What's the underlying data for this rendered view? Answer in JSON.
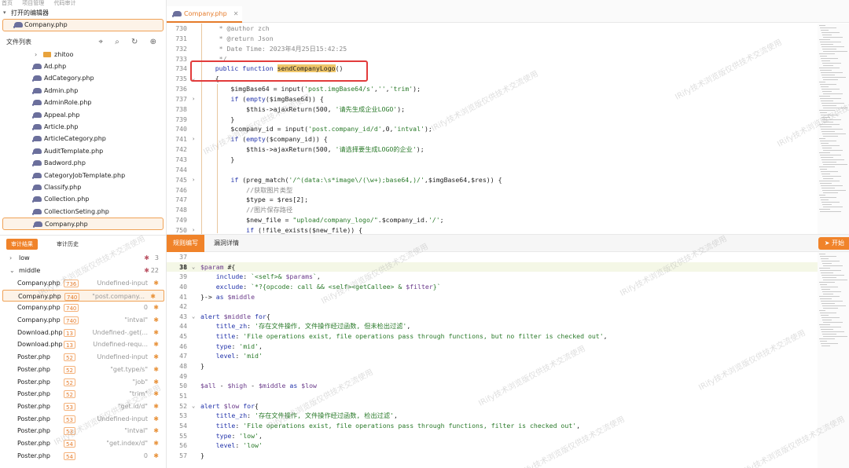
{
  "breadcrumb": [
    "首页",
    "项目管理",
    "代码审计"
  ],
  "open_editors": {
    "title": "打开的编辑器",
    "file": "Company.php"
  },
  "files": {
    "title": "文件列表",
    "folder": "zhitoo",
    "items": [
      "Ad.php",
      "AdCategory.php",
      "Admin.php",
      "AdminRole.php",
      "Appeal.php",
      "Article.php",
      "ArticleCategory.php",
      "AuditTemplate.php",
      "Badword.php",
      "CategoryJobTemplate.php",
      "Classify.php",
      "Collection.php",
      "CollectionSeting.php",
      "Company.php"
    ]
  },
  "result_tabs": {
    "active": "审计结果",
    "other": "审计历史"
  },
  "groups": {
    "low": {
      "label": "low",
      "count": "3"
    },
    "middle": {
      "label": "middle",
      "count": "22"
    }
  },
  "results": [
    {
      "file": "Company.php",
      "line": "736",
      "value": "Undefined-input"
    },
    {
      "file": "Company.php",
      "line": "740",
      "value": "\"post.company..."
    },
    {
      "file": "Company.php",
      "line": "740",
      "value": "0"
    },
    {
      "file": "Company.php",
      "line": "740",
      "value": "\"intval\""
    },
    {
      "file": "Download.php",
      "line": "13",
      "value": "Undefined-.get(..."
    },
    {
      "file": "Download.php",
      "line": "13",
      "value": "Undefined-requ..."
    },
    {
      "file": "Poster.php",
      "line": "52",
      "value": "Undefined-input"
    },
    {
      "file": "Poster.php",
      "line": "52",
      "value": "\"get.type/s\""
    },
    {
      "file": "Poster.php",
      "line": "52",
      "value": "\"job\""
    },
    {
      "file": "Poster.php",
      "line": "52",
      "value": "\"trim\""
    },
    {
      "file": "Poster.php",
      "line": "53",
      "value": "\"get.id/d\""
    },
    {
      "file": "Poster.php",
      "line": "53",
      "value": "Undefined-input"
    },
    {
      "file": "Poster.php",
      "line": "53",
      "value": "\"intval\""
    },
    {
      "file": "Poster.php",
      "line": "54",
      "value": "\"get.index/d\""
    },
    {
      "file": "Poster.php",
      "line": "54",
      "value": "0"
    }
  ],
  "editor_tab": "Company.php",
  "code": [
    {
      "n": "730",
      "t": "     * @author zch"
    },
    {
      "n": "731",
      "t": "     * @return Json"
    },
    {
      "n": "732",
      "t": "     * Date Time: 2023年4月25日15:42:25"
    },
    {
      "n": "733",
      "t": "     */"
    },
    {
      "n": "734",
      "t": "    public function sendCompanyLogo()"
    },
    {
      "n": "735",
      "t": "    {"
    },
    {
      "n": "736",
      "t": "        $imgBase64 = input('post.imgBase64/s','','trim');"
    },
    {
      "n": "737",
      "t": "        if (empty($imgBase64)) {"
    },
    {
      "n": "738",
      "t": "            $this->ajaxReturn(500, '请先生成企业LOGO');"
    },
    {
      "n": "739",
      "t": "        }"
    },
    {
      "n": "740",
      "t": "        $company_id = input('post.company_id/d',0,'intval');"
    },
    {
      "n": "741",
      "t": "        if (empty($company_id)) {"
    },
    {
      "n": "742",
      "t": "            $this->ajaxReturn(500, '请选择要生成LOGO的企业');"
    },
    {
      "n": "743",
      "t": "        }"
    },
    {
      "n": "744",
      "t": ""
    },
    {
      "n": "745",
      "t": "        if (preg_match('/^(data:\\s*image\\/(\\w+);base64,)/',$imgBase64,$res)) {"
    },
    {
      "n": "746",
      "t": "            //获取图片类型"
    },
    {
      "n": "747",
      "t": "            $type = $res[2];"
    },
    {
      "n": "748",
      "t": "            //图片保存路径"
    },
    {
      "n": "749",
      "t": "            $new_file = \"upload/company_logo/\".$company_id.'/';"
    },
    {
      "n": "750",
      "t": "            if (!file_exists($new_file)) {"
    }
  ],
  "bottom_tabs": {
    "active": "规则编写",
    "other": "漏洞详情"
  },
  "start_button": "开始",
  "rules": [
    {
      "n": "37",
      "t": ""
    },
    {
      "n": "38",
      "t": "$param #{"
    },
    {
      "n": "39",
      "t": "    include: `<self>& $params`,"
    },
    {
      "n": "40",
      "t": "    exclude: `*?{opcode: call && <self><getCallee> & $filter}`"
    },
    {
      "n": "41",
      "t": "}-> as $middle"
    },
    {
      "n": "42",
      "t": ""
    },
    {
      "n": "43",
      "t": "alert $middle for{"
    },
    {
      "n": "44",
      "t": "    title_zh: '存在文件操作, 文件操作经过函数, 但未检出过滤',"
    },
    {
      "n": "45",
      "t": "    title: 'File operations exist, file operations pass through functions, but no filter is checked out',"
    },
    {
      "n": "46",
      "t": "    type: 'mid',"
    },
    {
      "n": "47",
      "t": "    level: 'mid'"
    },
    {
      "n": "48",
      "t": "}"
    },
    {
      "n": "49",
      "t": ""
    },
    {
      "n": "50",
      "t": "$all - $high - $middle as $low"
    },
    {
      "n": "51",
      "t": ""
    },
    {
      "n": "52",
      "t": "alert $low for{"
    },
    {
      "n": "53",
      "t": "    title_zh: '存在文件操作, 文件操作经过函数, 检出过滤',"
    },
    {
      "n": "54",
      "t": "    title: 'File operations exist, file operations pass through functions, filter is checked out',"
    },
    {
      "n": "55",
      "t": "    type: 'low',"
    },
    {
      "n": "56",
      "t": "    level: 'low'"
    },
    {
      "n": "57",
      "t": "}"
    }
  ],
  "watermark": "IRify技术浏览版仅供技术交流使用",
  "colors": {
    "accent": "#f0832a",
    "highlight_box": "#e23b3b",
    "selection": "#fdf3e8"
  }
}
